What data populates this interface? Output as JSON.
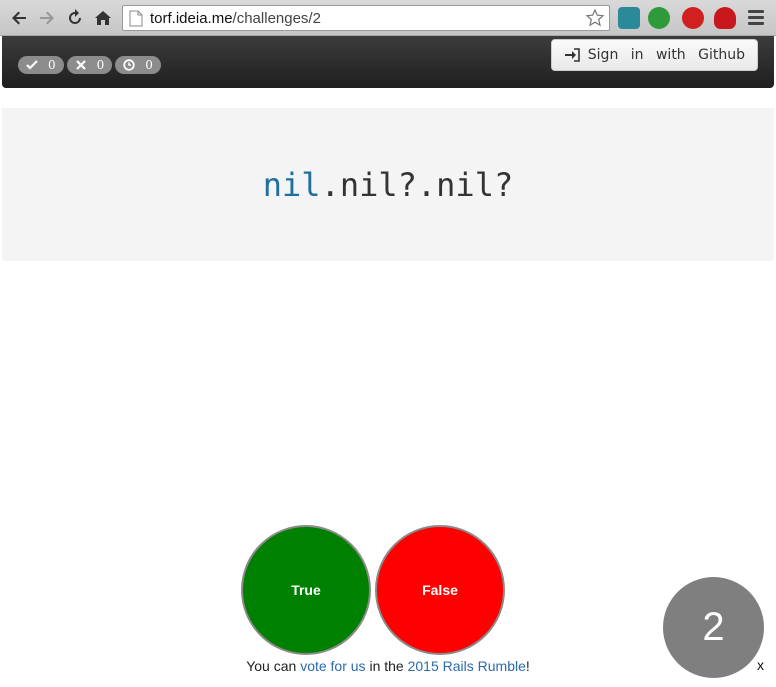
{
  "browser": {
    "url_host": "torf.ideia.me",
    "url_path": "/challenges/2"
  },
  "navbar": {
    "badges": [
      {
        "icon": "check-icon",
        "count": "0"
      },
      {
        "icon": "x-icon",
        "count": "0"
      },
      {
        "icon": "clock-icon",
        "count": "0"
      }
    ],
    "signin_label": "Sign in with Github"
  },
  "challenge": {
    "kw": "nil",
    "rest": ".nil?.nil?"
  },
  "answers": {
    "true_label": "True",
    "false_label": "False"
  },
  "footer": {
    "prefix": "You can ",
    "vote_link": "vote for us",
    "middle": " in the ",
    "rumble_link": "2015 Rails Rumble",
    "suffix": "!"
  },
  "counter": "2",
  "close_label": "x",
  "colors": {
    "true": "#008000",
    "false": "#ff0000",
    "counter": "#7f7f7f",
    "keyword": "#1f6f9f"
  }
}
